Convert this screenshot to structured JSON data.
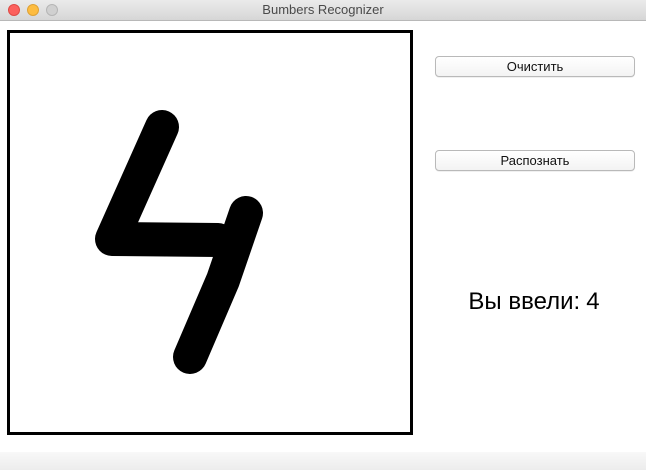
{
  "window": {
    "title": "Bumbers Recognizer"
  },
  "controls": {
    "clear_label": "Очистить",
    "recognize_label": "Распознать"
  },
  "result": {
    "prefix": "Вы ввели:",
    "value": "4"
  },
  "canvas": {
    "drawn_digit": "4",
    "stroke_color": "#000000",
    "background_color": "#ffffff"
  }
}
